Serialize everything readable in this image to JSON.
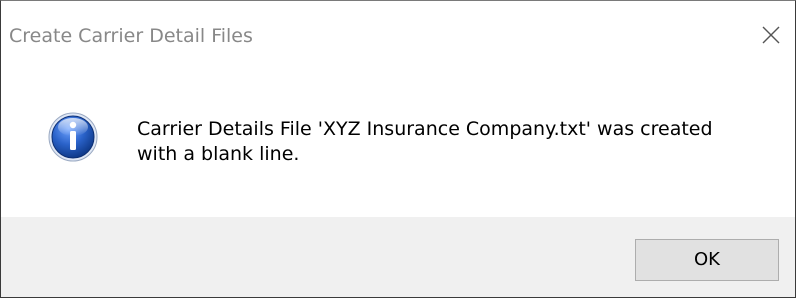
{
  "dialog": {
    "title": "Create Carrier Detail Files",
    "message_line1": "Carrier Details File 'XYZ Insurance Company.txt' was created",
    "message_line2": "with a blank line.",
    "icon": "info-icon",
    "ok_label": "OK",
    "close_icon": "close-icon"
  },
  "colors": {
    "title_text": "#888888",
    "footer_bg": "#f0f0f0",
    "button_bg": "#e1e1e1",
    "icon_blue": "#1c4fa8"
  }
}
